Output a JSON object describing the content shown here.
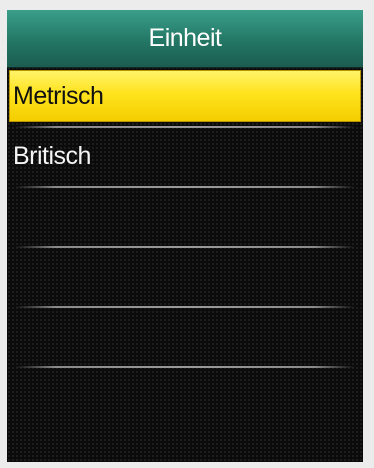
{
  "header": {
    "title": "Einheit"
  },
  "menu": {
    "items": [
      {
        "label": "Metrisch",
        "selected": true
      },
      {
        "label": "Britisch",
        "selected": false
      },
      {
        "label": "",
        "selected": false
      },
      {
        "label": "",
        "selected": false
      },
      {
        "label": "",
        "selected": false
      },
      {
        "label": "",
        "selected": false
      }
    ]
  },
  "colors": {
    "header": "#237664",
    "highlight": "#ffe31c",
    "background": "#0b0b0b",
    "text": "#f4f4f4"
  }
}
